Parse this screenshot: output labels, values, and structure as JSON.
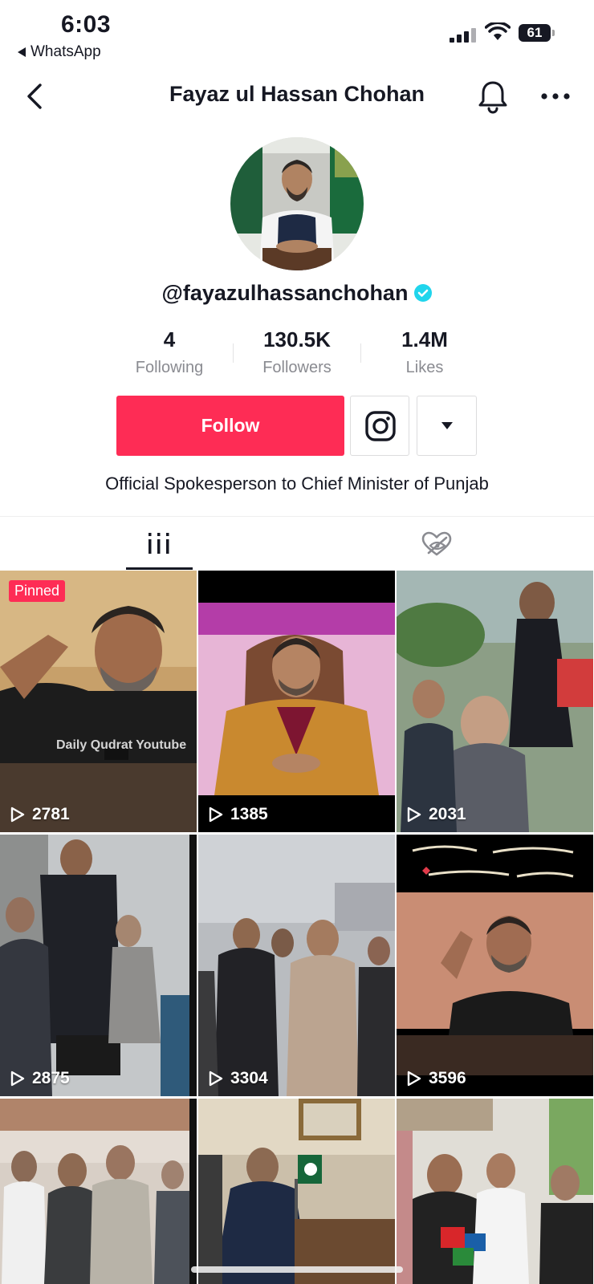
{
  "status_bar": {
    "time": "6:03",
    "back_app": "WhatsApp",
    "battery": "61"
  },
  "nav": {
    "title": "Fayaz ul Hassan Chohan"
  },
  "profile": {
    "handle": "@fayazulhassanchohan",
    "verified": true,
    "stats": {
      "following": {
        "value": "4",
        "label": "Following"
      },
      "followers": {
        "value": "130.5K",
        "label": "Followers"
      },
      "likes": {
        "value": "1.4M",
        "label": "Likes"
      }
    },
    "follow_label": "Follow",
    "bio": "Official Spokesperson to Chief Minister of Punjab"
  },
  "tabs": [
    {
      "name": "videos",
      "icon": "grid-lines-icon",
      "active": true
    },
    {
      "name": "liked",
      "icon": "heart-hidden-icon",
      "active": false
    }
  ],
  "videos": [
    {
      "views": "2781",
      "pinned_label": "Pinned",
      "watermark": "Daily Qudrat Youtube"
    },
    {
      "views": "1385"
    },
    {
      "views": "2031"
    },
    {
      "views": "2875"
    },
    {
      "views": "3304"
    },
    {
      "views": "3596"
    },
    {
      "views": ""
    },
    {
      "views": ""
    },
    {
      "views": ""
    }
  ],
  "colors": {
    "accent": "#fe2c55",
    "verified": "#20d5ec",
    "secondary_text": "#8a8b91"
  }
}
